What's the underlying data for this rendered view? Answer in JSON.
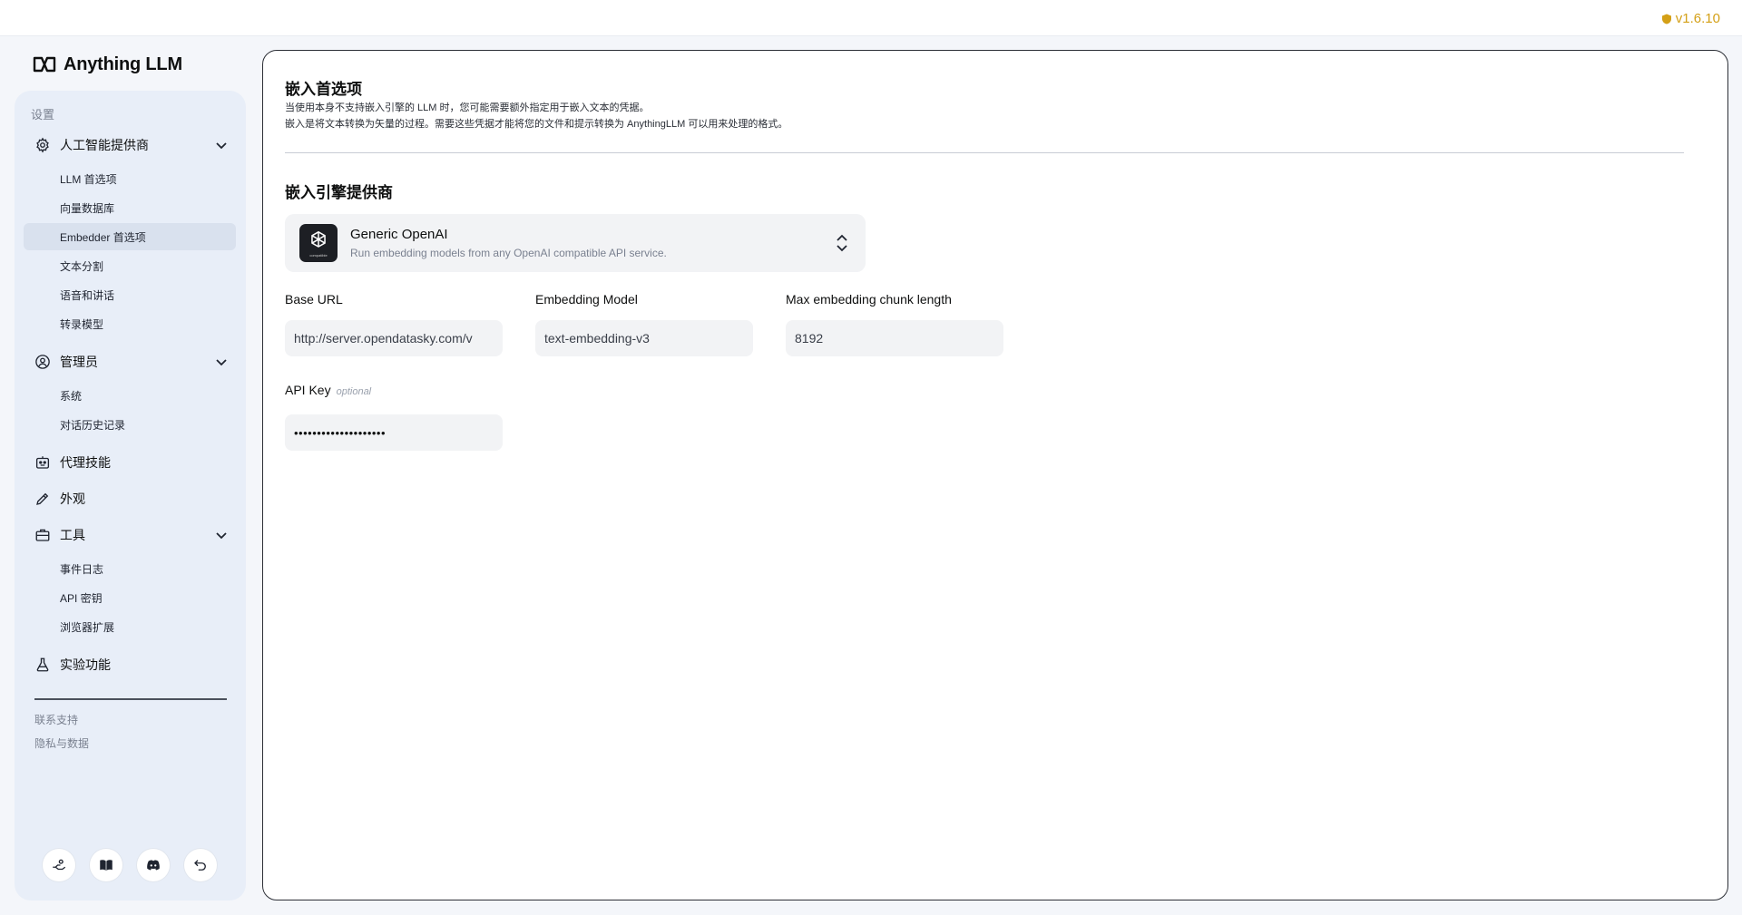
{
  "app": {
    "brand": "Anything LLM",
    "version": "v1.6.10"
  },
  "sidebar": {
    "section_title": "设置",
    "groups": [
      {
        "label": "人工智能提供商",
        "icon": "gear-icon",
        "items": [
          "LLM 首选项",
          "向量数据库",
          "Embedder 首选项",
          "文本分割",
          "语音和讲话",
          "转录模型"
        ]
      },
      {
        "label": "管理员",
        "icon": "user-gear-icon",
        "items": [
          "系统",
          "对话历史记录"
        ]
      },
      {
        "label": "代理技能",
        "icon": "robot-icon",
        "items": []
      },
      {
        "label": "外观",
        "icon": "pencil-icon",
        "items": []
      },
      {
        "label": "工具",
        "icon": "toolbox-icon",
        "items": [
          "事件日志",
          "API 密钥",
          "浏览器扩展"
        ]
      },
      {
        "label": "实验功能",
        "icon": "flask-icon",
        "items": []
      }
    ],
    "active_item": "Embedder 首选项",
    "footer_links": [
      "联系支持",
      "隐私与数据"
    ],
    "bottom_buttons": [
      "community-hub-icon",
      "book-icon",
      "discord-icon",
      "back-icon"
    ]
  },
  "main": {
    "title": "嵌入首选项",
    "description_line1": "当使用本身不支持嵌入引擎的 LLM 时，您可能需要额外指定用于嵌入文本的凭据。",
    "description_line2": "嵌入是将文本转换为矢量的过程。需要这些凭据才能将您的文件和提示转换为 AnythingLLM 可以用来处理的格式。",
    "section_title": "嵌入引擎提供商",
    "provider": {
      "name": "Generic OpenAI",
      "description": "Run embedding models from any OpenAI compatible API service.",
      "logo_caption": "compatible"
    },
    "fields": {
      "base_url": {
        "label": "Base URL",
        "value": "http://server.opendatasky.com/v"
      },
      "embedding_model": {
        "label": "Embedding Model",
        "value": "text-embedding-v3"
      },
      "max_chunk": {
        "label": "Max embedding chunk length",
        "value": "8192"
      },
      "api_key": {
        "label": "API Key",
        "optional": "optional",
        "value": "••••••••••••••••••••"
      }
    }
  }
}
